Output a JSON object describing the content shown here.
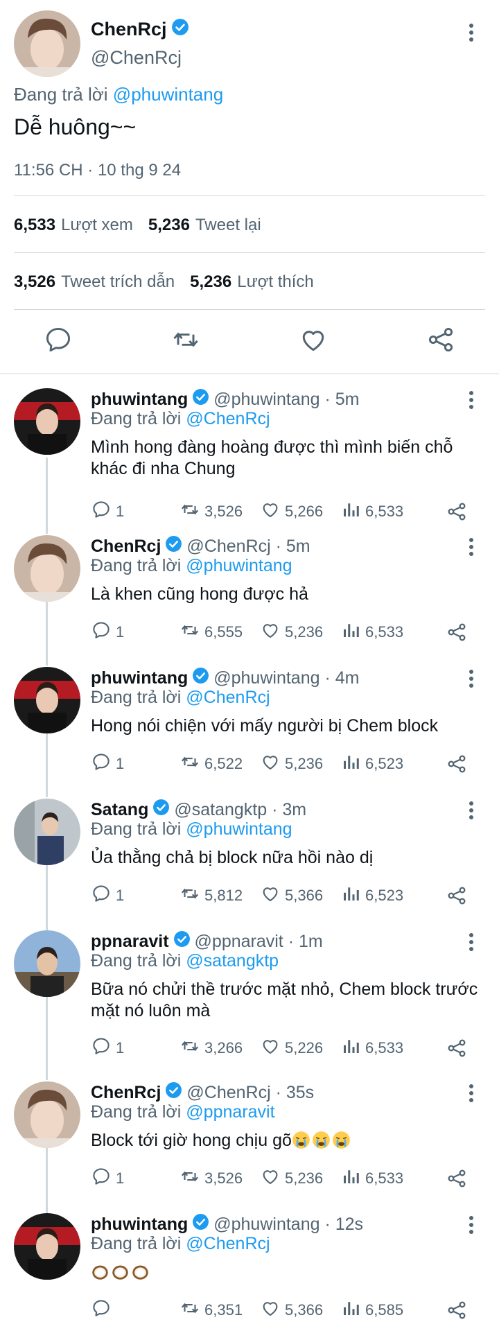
{
  "main": {
    "name": "ChenRcj",
    "handle": "@ChenRcj",
    "replying_prefix": "Đang trả lời",
    "replying_to": "@phuwintang",
    "text": "Dễ huông~~",
    "timestamp": "11:56 CH · 10 thg 9 24",
    "views_count": "6,533",
    "views_label": "Lượt xem",
    "retweets_count": "5,236",
    "retweets_label": "Tweet lại",
    "quotes_count": "3,526",
    "quotes_label": "Tweet trích dẫn",
    "likes_count": "5,236",
    "likes_label": "Lượt thích"
  },
  "replies": [
    {
      "name": "phuwintang",
      "handle": "@phuwintang · 5m",
      "reply_prefix": "Đang trả lời",
      "reply_to": "@ChenRcj",
      "text": "Mình hong đàng hoàng được thì mình biến chỗ khác đi nha Chung",
      "reply_count": "1",
      "retweet_count": "3,526",
      "like_count": "5,266",
      "view_count": "6,533"
    },
    {
      "name": "ChenRcj",
      "handle": "@ChenRcj · 5m",
      "reply_prefix": "Đang trả lời",
      "reply_to": "@phuwintang",
      "text": "Là khen cũng hong được hả",
      "reply_count": "1",
      "retweet_count": "6,555",
      "like_count": "5,236",
      "view_count": "6,533"
    },
    {
      "name": "phuwintang",
      "handle": "@phuwintang · 4m",
      "reply_prefix": "Đang trả lời",
      "reply_to": "@ChenRcj",
      "text": "Hong nói chiện với mấy người bị Chem block",
      "reply_count": "1",
      "retweet_count": "6,522",
      "like_count": "5,236",
      "view_count": "6,523"
    },
    {
      "name": "Satang",
      "handle": "@satangktp · 3m",
      "reply_prefix": "Đang trả lời",
      "reply_to": "@phuwintang",
      "text": "Ủa thằng chả bị block nữa hồi nào dị",
      "reply_count": "1",
      "retweet_count": "5,812",
      "like_count": "5,366",
      "view_count": "6,523"
    },
    {
      "name": "ppnaravit",
      "handle": "@ppnaravit · 1m",
      "reply_prefix": "Đang trả lời",
      "reply_to": "@satangktp",
      "text": "Bữa nó chửi thề trước mặt nhỏ, Chem block trước mặt nó luôn mà",
      "reply_count": "1",
      "retweet_count": "3,266",
      "like_count": "5,226",
      "view_count": "6,533"
    },
    {
      "name": "ChenRcj",
      "handle": "@ChenRcj · 35s",
      "reply_prefix": "Đang trả lời",
      "reply_to": "@ppnaravit",
      "text": "Block tới giờ hong chịu gõ",
      "emoji_name": "crying-face",
      "emoji_repeat": 3,
      "reply_count": "1",
      "retweet_count": "3,526",
      "like_count": "5,236",
      "view_count": "6,533"
    },
    {
      "name": "phuwintang",
      "handle": "@phuwintang · 12s",
      "reply_prefix": "Đang trả lời",
      "reply_to": "@ChenRcj",
      "text": "",
      "emoji_name": "coconut",
      "emoji_repeat": 3,
      "reply_count": "",
      "retweet_count": "6,351",
      "like_count": "5,366",
      "view_count": "6,585"
    }
  ],
  "icons": {
    "verified": "verified-badge-icon",
    "more": "more-vertical-icon",
    "reply": "reply-icon",
    "retweet": "retweet-icon",
    "like": "like-icon",
    "views": "views-icon",
    "share": "share-icon"
  },
  "colors": {
    "accent": "#1d9bf0",
    "secondary_text": "#536471",
    "divider": "#cfd9de"
  }
}
